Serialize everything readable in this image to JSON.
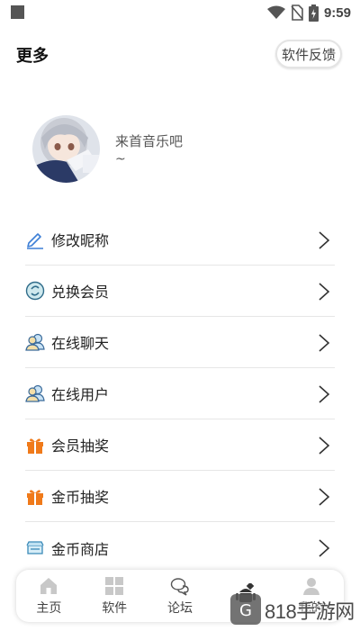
{
  "status_bar": {
    "time": "9:59"
  },
  "header": {
    "title": "更多",
    "feedback_label": "软件反馈"
  },
  "profile": {
    "name": "来首音乐吧",
    "subtitle": "~"
  },
  "menu": {
    "items": [
      {
        "label": "修改昵称",
        "icon": "edit-pencil-icon"
      },
      {
        "label": "兑换会员",
        "icon": "exchange-coin-icon"
      },
      {
        "label": "在线聊天",
        "icon": "users-chat-icon"
      },
      {
        "label": "在线用户",
        "icon": "users-online-icon"
      },
      {
        "label": "会员抽奖",
        "icon": "gift-icon"
      },
      {
        "label": "金币抽奖",
        "icon": "gift-icon"
      },
      {
        "label": "金币商店",
        "icon": "store-icon"
      }
    ]
  },
  "bottom_nav": {
    "items": [
      {
        "label": "主页",
        "icon": "home-icon"
      },
      {
        "label": "软件",
        "icon": "apps-icon"
      },
      {
        "label": "论坛",
        "icon": "chat-bubbles-icon"
      },
      {
        "label": "",
        "icon": "android-icon"
      },
      {
        "label": "我的",
        "icon": "user-icon"
      }
    ]
  },
  "watermark": {
    "text": "818手游网"
  },
  "colors": {
    "accent_blue": "#3d7fd6",
    "gift_orange": "#f07a1a",
    "divider": "#e6e6e6"
  }
}
